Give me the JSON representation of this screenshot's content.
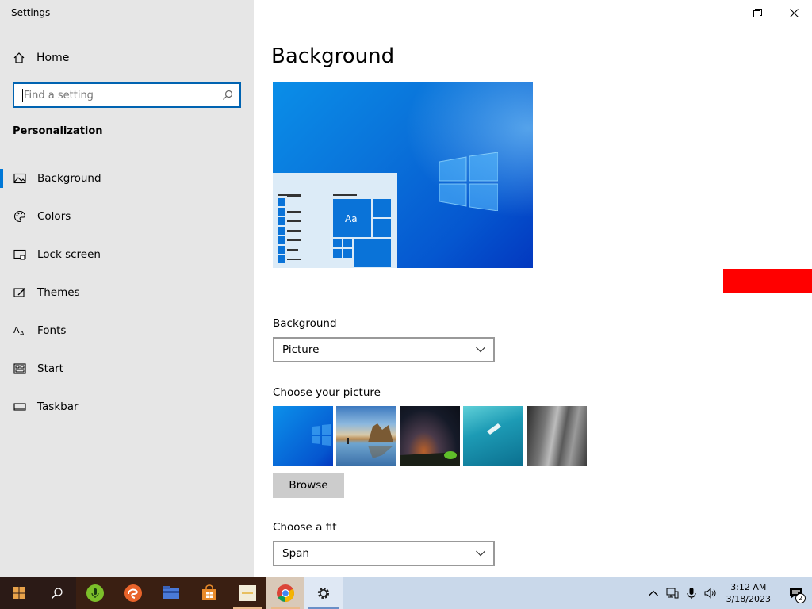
{
  "window": {
    "title": "Settings"
  },
  "sidebar": {
    "home_label": "Home",
    "search_placeholder": "Find a setting",
    "section_title": "Personalization",
    "items": [
      {
        "label": "Background",
        "icon": "image-icon",
        "active": true
      },
      {
        "label": "Colors",
        "icon": "palette-icon"
      },
      {
        "label": "Lock screen",
        "icon": "lock-screen-icon"
      },
      {
        "label": "Themes",
        "icon": "themes-icon"
      },
      {
        "label": "Fonts",
        "icon": "fonts-icon"
      },
      {
        "label": "Start",
        "icon": "start-icon"
      },
      {
        "label": "Taskbar",
        "icon": "taskbar-icon"
      }
    ]
  },
  "main": {
    "title": "Background",
    "preview_tile_label": "Aa",
    "background_label": "Background",
    "background_value": "Picture",
    "choose_picture_label": "Choose your picture",
    "browse_label": "Browse",
    "fit_label": "Choose a fit",
    "fit_value": "Span"
  },
  "taskbar": {
    "time": "3:12 AM",
    "date": "3/18/2023",
    "notification_count": "2"
  },
  "colors": {
    "accent": "#0078d7",
    "sidebar_bg": "#e6e6e6",
    "taskbar_bg": "#c9d8ea",
    "marker": "#ff0000"
  }
}
